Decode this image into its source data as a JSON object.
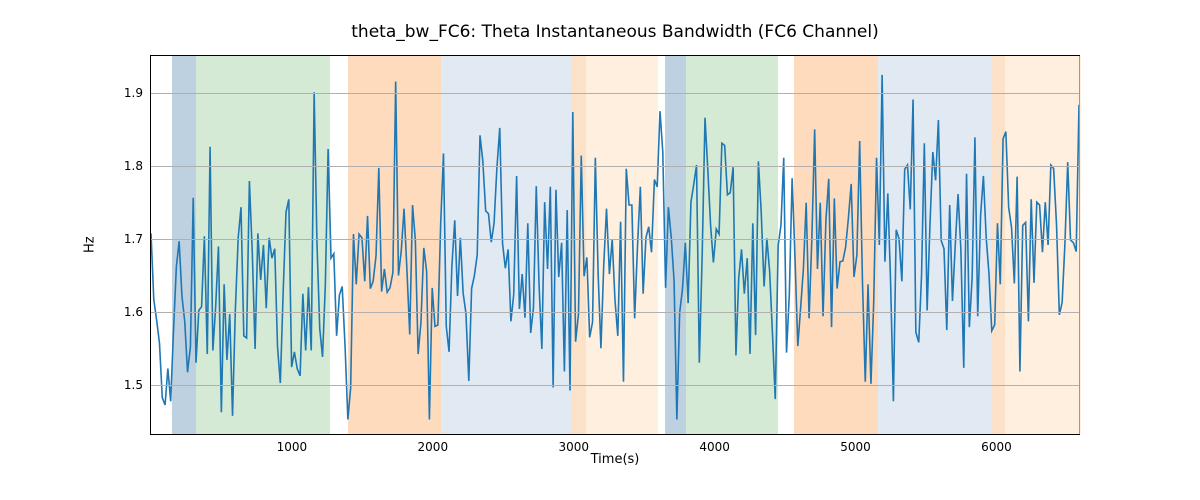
{
  "chart_data": {
    "type": "line",
    "title": "theta_bw_FC6: Theta Instantaneous Bandwidth (FC6 Channel)",
    "xlabel": "Time(s)",
    "ylabel": "Hz",
    "xlim": [
      0,
      6600
    ],
    "ylim": [
      1.43,
      1.95
    ],
    "yticks": [
      1.5,
      1.6,
      1.7,
      1.8,
      1.9
    ],
    "xticks": [
      1000,
      2000,
      3000,
      4000,
      5000,
      6000
    ],
    "regions": [
      {
        "x0": 150,
        "x1": 320,
        "color": "rgba(111,152,186,0.45)"
      },
      {
        "x0": 320,
        "x1": 1270,
        "color": "rgba(176,216,176,0.55)"
      },
      {
        "x0": 1400,
        "x1": 2060,
        "color": "rgba(253,190,133,0.55)"
      },
      {
        "x0": 2060,
        "x1": 2980,
        "color": "rgba(200,216,233,0.55)"
      },
      {
        "x0": 2980,
        "x1": 3090,
        "color": "rgba(249,203,156,0.55)"
      },
      {
        "x0": 3090,
        "x1": 3600,
        "color": "rgba(254,230,206,0.65)"
      },
      {
        "x0": 3650,
        "x1": 3800,
        "color": "rgba(111,152,186,0.45)"
      },
      {
        "x0": 3800,
        "x1": 4450,
        "color": "rgba(176,216,176,0.55)"
      },
      {
        "x0": 4560,
        "x1": 5160,
        "color": "rgba(253,190,133,0.55)"
      },
      {
        "x0": 5160,
        "x1": 5960,
        "color": "rgba(200,216,233,0.55)"
      },
      {
        "x0": 5960,
        "x1": 6060,
        "color": "rgba(249,203,156,0.55)"
      },
      {
        "x0": 6060,
        "x1": 6600,
        "color": "rgba(254,230,206,0.65)"
      }
    ],
    "x": [
      0,
      20,
      40,
      60,
      80,
      100,
      120,
      140,
      160,
      180,
      200,
      220,
      240,
      260,
      280,
      300,
      320,
      340,
      360,
      380,
      400,
      420,
      440,
      460,
      480,
      500,
      520,
      540,
      560,
      580,
      600,
      620,
      640,
      660,
      680,
      700,
      720,
      740,
      760,
      780,
      800,
      820,
      840,
      860,
      880,
      900,
      920,
      940,
      960,
      980,
      1000,
      1020,
      1040,
      1060,
      1080,
      1100,
      1120,
      1140,
      1160,
      1180,
      1200,
      1220,
      1240,
      1260,
      1280,
      1300,
      1320,
      1340,
      1360,
      1380,
      1400,
      1420,
      1440,
      1460,
      1480,
      1500,
      1520,
      1540,
      1560,
      1580,
      1600,
      1620,
      1640,
      1660,
      1680,
      1700,
      1720,
      1740,
      1760,
      1780,
      1800,
      1820,
      1840,
      1860,
      1880,
      1900,
      1920,
      1940,
      1960,
      1980,
      2000,
      2020,
      2040,
      2060,
      2080,
      2100,
      2120,
      2140,
      2160,
      2180,
      2200,
      2220,
      2240,
      2260,
      2280,
      2300,
      2320,
      2340,
      2360,
      2380,
      2400,
      2420,
      2440,
      2460,
      2480,
      2500,
      2520,
      2540,
      2560,
      2580,
      2600,
      2620,
      2640,
      2660,
      2680,
      2700,
      2720,
      2740,
      2760,
      2780,
      2800,
      2820,
      2840,
      2860,
      2880,
      2900,
      2920,
      2940,
      2960,
      2980,
      3000,
      3020,
      3040,
      3060,
      3080,
      3100,
      3120,
      3140,
      3160,
      3180,
      3200,
      3220,
      3240,
      3260,
      3280,
      3300,
      3320,
      3340,
      3360,
      3380,
      3400,
      3420,
      3440,
      3460,
      3480,
      3500,
      3520,
      3540,
      3560,
      3580,
      3600,
      3620,
      3640,
      3660,
      3680,
      3700,
      3720,
      3740,
      3760,
      3780,
      3800,
      3820,
      3840,
      3860,
      3880,
      3900,
      3920,
      3940,
      3960,
      3980,
      4000,
      4020,
      4040,
      4060,
      4080,
      4100,
      4120,
      4140,
      4160,
      4180,
      4200,
      4220,
      4240,
      4260,
      4280,
      4300,
      4320,
      4340,
      4360,
      4380,
      4400,
      4420,
      4440,
      4460,
      4480,
      4500,
      4520,
      4540,
      4560,
      4580,
      4600,
      4620,
      4640,
      4660,
      4680,
      4700,
      4720,
      4740,
      4760,
      4780,
      4800,
      4820,
      4840,
      4860,
      4880,
      4900,
      4920,
      4940,
      4960,
      4980,
      5000,
      5020,
      5040,
      5060,
      5080,
      5100,
      5120,
      5140,
      5160,
      5180,
      5200,
      5220,
      5240,
      5260,
      5280,
      5300,
      5320,
      5340,
      5360,
      5380,
      5400,
      5420,
      5440,
      5460,
      5480,
      5500,
      5520,
      5540,
      5560,
      5580,
      5600,
      5620,
      5640,
      5660,
      5680,
      5700,
      5720,
      5740,
      5760,
      5780,
      5800,
      5820,
      5840,
      5860,
      5880,
      5900,
      5920,
      5940,
      5960,
      5980,
      6000,
      6020,
      6040,
      6060,
      6080,
      6100,
      6120,
      6140,
      6160,
      6180,
      6200,
      6220,
      6240,
      6260,
      6280,
      6300,
      6320,
      6340,
      6360,
      6380,
      6400,
      6420,
      6440,
      6460,
      6480,
      6500,
      6520,
      6540,
      6560,
      6580,
      6600
    ],
    "y": [
      1.706,
      1.615,
      1.587,
      1.555,
      1.48,
      1.47,
      1.52,
      1.475,
      1.57,
      1.66,
      1.695,
      1.62,
      1.585,
      1.515,
      1.55,
      1.755,
      1.528,
      1.6,
      1.605,
      1.702,
      1.54,
      1.825,
      1.545,
      1.605,
      1.688,
      1.46,
      1.636,
      1.532,
      1.595,
      1.455,
      1.6,
      1.7,
      1.742,
      1.565,
      1.562,
      1.778,
      1.68,
      1.547,
      1.706,
      1.642,
      1.69,
      1.603,
      1.7,
      1.672,
      1.685,
      1.55,
      1.5,
      1.627,
      1.735,
      1.753,
      1.522,
      1.543,
      1.52,
      1.51,
      1.623,
      1.545,
      1.632,
      1.545,
      1.9,
      1.694,
      1.575,
      1.536,
      1.635,
      1.822,
      1.672,
      1.678,
      1.565,
      1.621,
      1.633,
      1.55,
      1.45,
      1.494,
      1.705,
      1.636,
      1.705,
      1.7,
      1.64,
      1.73,
      1.63,
      1.64,
      1.675,
      1.796,
      1.626,
      1.657,
      1.625,
      1.631,
      1.652,
      1.915,
      1.648,
      1.682,
      1.74,
      1.655,
      1.567,
      1.745,
      1.697,
      1.54,
      1.583,
      1.686,
      1.654,
      1.45,
      1.631,
      1.578,
      1.58,
      1.719,
      1.816,
      1.578,
      1.543,
      1.66,
      1.724,
      1.62,
      1.7,
      1.624,
      1.596,
      1.503,
      1.63,
      1.648,
      1.676,
      1.841,
      1.806,
      1.737,
      1.733,
      1.694,
      1.72,
      1.795,
      1.851,
      1.692,
      1.658,
      1.684,
      1.585,
      1.622,
      1.785,
      1.602,
      1.65,
      1.59,
      1.72,
      1.569,
      1.604,
      1.771,
      1.635,
      1.547,
      1.749,
      1.657,
      1.77,
      1.494,
      1.766,
      1.646,
      1.693,
      1.516,
      1.738,
      1.49,
      1.873,
      1.557,
      1.595,
      1.813,
      1.647,
      1.673,
      1.563,
      1.584,
      1.81,
      1.65,
      1.548,
      1.662,
      1.74,
      1.65,
      1.698,
      1.614,
      1.565,
      1.722,
      1.502,
      1.795,
      1.745,
      1.745,
      1.589,
      1.687,
      1.77,
      1.623,
      1.7,
      1.715,
      1.68,
      1.78,
      1.77,
      1.874,
      1.818,
      1.631,
      1.742,
      1.7,
      1.641,
      1.45,
      1.597,
      1.629,
      1.693,
      1.61,
      1.749,
      1.773,
      1.8,
      1.528,
      1.678,
      1.865,
      1.794,
      1.717,
      1.666,
      1.712,
      1.705,
      1.83,
      1.827,
      1.759,
      1.762,
      1.797,
      1.538,
      1.645,
      1.684,
      1.623,
      1.672,
      1.54,
      1.72,
      1.566,
      1.805,
      1.736,
      1.633,
      1.699,
      1.653,
      1.568,
      1.478,
      1.689,
      1.717,
      1.81,
      1.542,
      1.622,
      1.782,
      1.672,
      1.551,
      1.603,
      1.657,
      1.748,
      1.589,
      1.7,
      1.849,
      1.657,
      1.748,
      1.592,
      1.725,
      1.781,
      1.577,
      1.754,
      1.63,
      1.667,
      1.668,
      1.687,
      1.727,
      1.774,
      1.646,
      1.676,
      1.833,
      1.64,
      1.502,
      1.636,
      1.499,
      1.613,
      1.81,
      1.69,
      1.924,
      1.667,
      1.761,
      1.638,
      1.475,
      1.711,
      1.699,
      1.64,
      1.794,
      1.8,
      1.739,
      1.89,
      1.57,
      1.556,
      1.648,
      1.83,
      1.6,
      1.716,
      1.818,
      1.779,
      1.862,
      1.696,
      1.685,
      1.573,
      1.745,
      1.613,
      1.69,
      1.76,
      1.684,
      1.521,
      1.788,
      1.577,
      1.645,
      1.838,
      1.592,
      1.731,
      1.785,
      1.7,
      1.65,
      1.572,
      1.58,
      1.72,
      1.636,
      1.836,
      1.846,
      1.742,
      1.714,
      1.637,
      1.784,
      1.516,
      1.717,
      1.721,
      1.585,
      1.753,
      1.638,
      1.749,
      1.745,
      1.68,
      1.749,
      1.69,
      1.8,
      1.795,
      1.717,
      1.594,
      1.611,
      1.692,
      1.804,
      1.697,
      1.693,
      1.681,
      1.883
    ]
  }
}
